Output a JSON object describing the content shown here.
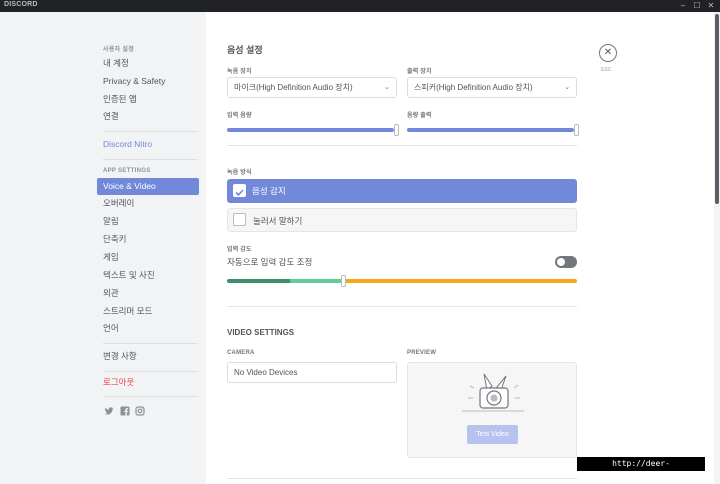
{
  "titlebar": {
    "brand": "DISCORD",
    "minimize": "–",
    "maximize": "☐",
    "close": "✕"
  },
  "sidebar": {
    "user_settings_header": "사용자 설정",
    "user_items": [
      "내 계정",
      "Privacy & Safety",
      "인증된 앱",
      "연결"
    ],
    "nitro": "Discord Nitro",
    "app_settings_header": "APP SETTINGS",
    "app_items": [
      "Voice & Video",
      "오버레이",
      "알림",
      "단축키",
      "게임",
      "텍스트 및 사진",
      "외관",
      "스트리머 모드",
      "언어"
    ],
    "change_log": "변경 사항",
    "logout": "로그아웃",
    "social_icons": [
      "twitter-icon",
      "facebook-icon",
      "instagram-icon"
    ]
  },
  "voice": {
    "title": "음성 설정",
    "input_device_label": "녹음 장치",
    "input_device_value": "마이크(High Definition Audio 장치)",
    "output_device_label": "출력 장치",
    "output_device_value": "스피커(High Definition Audio 장치)",
    "input_volume_label": "입력 음량",
    "output_volume_label": "음량 출력",
    "input_volume_level": 1.0,
    "output_volume_level": 1.0,
    "input_mode_label": "녹음 방식",
    "input_modes": [
      "음성 감지",
      "눌러서 말하기"
    ],
    "selected_mode": "음성 감지",
    "sensitivity_label": "입력 감도",
    "auto_sensitivity_label": "자동으로 입력 감도 조정",
    "auto_sensitivity_enabled": false,
    "sensitivity_threshold": 0.33
  },
  "video": {
    "title": "VIDEO SETTINGS",
    "camera_label": "CAMERA",
    "camera_value": "No Video Devices",
    "preview_label": "PREVIEW",
    "test_button": "Test Video"
  },
  "close": {
    "icon": "close-icon",
    "esc_label": "ESC"
  },
  "watermark": "http://deer-kkr.tistory.com",
  "colors": {
    "accent": "#7289da",
    "danger": "#f04747",
    "warning": "#faa61a",
    "success": "#43b581",
    "sidebar_bg": "#f2f3f5"
  }
}
